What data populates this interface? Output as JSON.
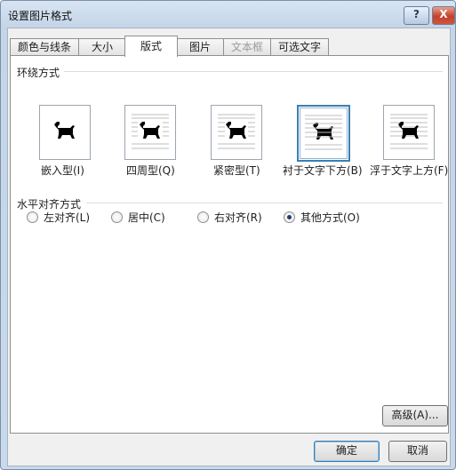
{
  "window": {
    "title": "设置图片格式",
    "help_label": "?",
    "close_label": "X"
  },
  "tabs": [
    {
      "label": "颜色与线条"
    },
    {
      "label": "大小"
    },
    {
      "label": "版式"
    },
    {
      "label": "图片"
    },
    {
      "label": "文本框"
    },
    {
      "label": "可选文字"
    }
  ],
  "active_tab": "版式",
  "wrap_section": {
    "title": "环绕方式",
    "options": [
      {
        "label": "嵌入型(I)"
      },
      {
        "label": "四周型(Q)"
      },
      {
        "label": "紧密型(T)"
      },
      {
        "label": "衬于文字下方(B)"
      },
      {
        "label": "浮于文字上方(F)"
      }
    ],
    "selected": "衬于文字下方(B)"
  },
  "align_section": {
    "title": "水平对齐方式",
    "options": [
      {
        "label": "左对齐(L)"
      },
      {
        "label": "居中(C)"
      },
      {
        "label": "右对齐(R)"
      },
      {
        "label": "其他方式(O)"
      }
    ],
    "selected": "其他方式(O)"
  },
  "buttons": {
    "advanced": "高级(A)...",
    "ok": "确定",
    "cancel": "取消"
  },
  "icons": {
    "wrap_preview": "dog-silhouette-icon"
  }
}
